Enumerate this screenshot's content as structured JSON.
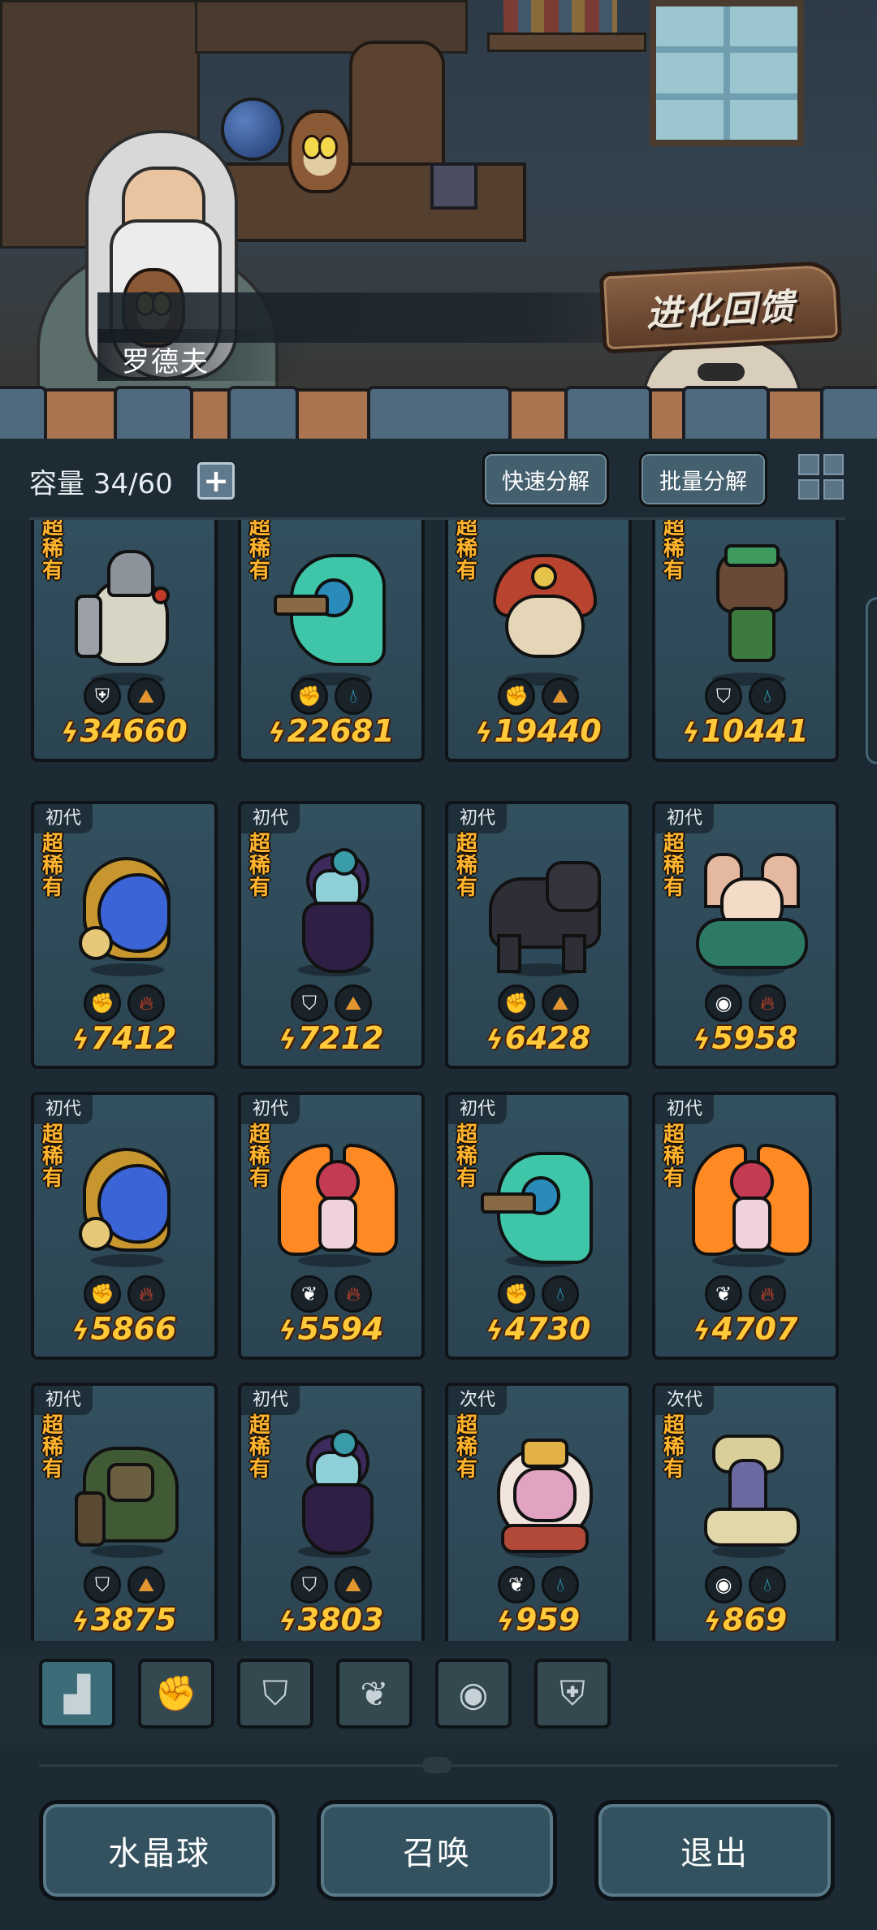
{
  "scene": {
    "speaker_name": "罗德夫",
    "evolve_feedback_label": "进化回馈"
  },
  "toolbar": {
    "capacity_label": "容量 34/60",
    "add_label": "+",
    "quick_decompose_label": "快速分解",
    "batch_decompose_label": "批量分解"
  },
  "cards": [
    {
      "generation": "",
      "rarity": "超稀有",
      "power": "34660",
      "class_icon": "shield-crest-icon",
      "element_icon": "earth-element-icon",
      "creature": "armored-rat"
    },
    {
      "generation": "",
      "rarity": "超稀有",
      "power": "22681",
      "class_icon": "fist-icon",
      "element_icon": "water-element-icon",
      "creature": "water-spirit"
    },
    {
      "generation": "",
      "rarity": "超稀有",
      "power": "19440",
      "class_icon": "fist-icon",
      "element_icon": "earth-element-icon",
      "creature": "mushroom-blob"
    },
    {
      "generation": "",
      "rarity": "超稀有",
      "power": "10441",
      "class_icon": "shield-icon",
      "element_icon": "water-element-icon",
      "creature": "tree-sprite"
    },
    {
      "generation": "初代",
      "rarity": "超稀有",
      "power": "7412",
      "class_icon": "fist-icon",
      "element_icon": "fire-element-icon",
      "creature": "blue-flame-spirit"
    },
    {
      "generation": "初代",
      "rarity": "超稀有",
      "power": "7212",
      "class_icon": "shield-icon",
      "element_icon": "earth-element-icon",
      "creature": "rose-witch"
    },
    {
      "generation": "初代",
      "rarity": "超稀有",
      "power": "6428",
      "class_icon": "fist-icon",
      "element_icon": "earth-element-icon",
      "creature": "dark-wolf"
    },
    {
      "generation": "初代",
      "rarity": "超稀有",
      "power": "5958",
      "class_icon": "eye-icon",
      "element_icon": "fire-element-icon",
      "creature": "fox-girl"
    },
    {
      "generation": "初代",
      "rarity": "超稀有",
      "power": "5866",
      "class_icon": "fist-icon",
      "element_icon": "fire-element-icon",
      "creature": "blue-flame-spirit"
    },
    {
      "generation": "初代",
      "rarity": "超稀有",
      "power": "5594",
      "class_icon": "sprout-icon",
      "element_icon": "fire-element-icon",
      "creature": "phoenix-fairy"
    },
    {
      "generation": "初代",
      "rarity": "超稀有",
      "power": "4730",
      "class_icon": "fist-icon",
      "element_icon": "water-element-icon",
      "creature": "water-spirit"
    },
    {
      "generation": "初代",
      "rarity": "超稀有",
      "power": "4707",
      "class_icon": "sprout-icon",
      "element_icon": "fire-element-icon",
      "creature": "phoenix-fairy"
    },
    {
      "generation": "初代",
      "rarity": "超稀有",
      "power": "3875",
      "class_icon": "shield-icon",
      "element_icon": "earth-element-icon",
      "creature": "moss-golem"
    },
    {
      "generation": "初代",
      "rarity": "超稀有",
      "power": "3803",
      "class_icon": "shield-icon",
      "element_icon": "earth-element-icon",
      "creature": "rose-witch"
    },
    {
      "generation": "次代",
      "rarity": "超稀有",
      "power": "959",
      "class_icon": "sprout-icon",
      "element_icon": "water-element-icon",
      "creature": "pink-larva"
    },
    {
      "generation": "次代",
      "rarity": "超稀有",
      "power": "869",
      "class_icon": "eye-icon",
      "element_icon": "water-element-icon",
      "creature": "bone-serpent"
    }
  ],
  "filter_tabs": [
    {
      "name": "all-filter-tab",
      "icon": "blocks-icon",
      "active": true
    },
    {
      "name": "fist-filter-tab",
      "icon": "fist-icon",
      "active": false
    },
    {
      "name": "shield-filter-tab",
      "icon": "shield-icon",
      "active": false
    },
    {
      "name": "sprout-filter-tab",
      "icon": "sprout-icon",
      "active": false
    },
    {
      "name": "eye-filter-tab",
      "icon": "eye-icon",
      "active": false
    },
    {
      "name": "crest-filter-tab",
      "icon": "shield-crest-icon",
      "active": false
    }
  ],
  "bottom": {
    "crystal_ball_label": "水晶球",
    "summon_label": "召唤",
    "exit_label": "退出"
  },
  "colors": {
    "power_text": "#ffca3a",
    "rarity_text": "#ffb52e",
    "card_bg": "#33505e",
    "button_bg": "#33515f"
  }
}
